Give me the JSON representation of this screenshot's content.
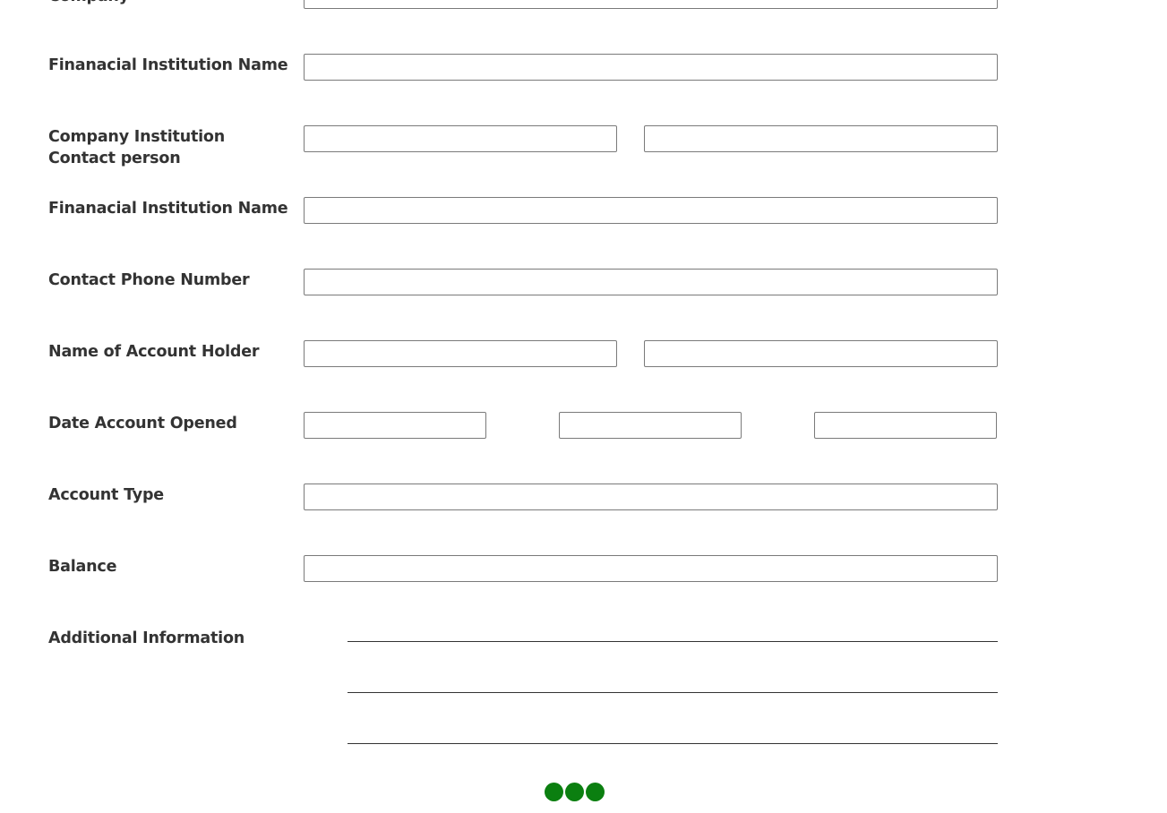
{
  "form": {
    "partial_label_top": "Company",
    "labels": {
      "financial_institution_name_1": "Finanacial Institution Name",
      "company_contact_person": "Company Institution Contact person",
      "financial_institution_name_2": "Finanacial Institution Name",
      "contact_phone_number": "Contact Phone Number",
      "name_of_account_holder": "Name of Account Holder",
      "date_account_opened": "Date Account Opened",
      "account_type": "Account Type",
      "balance": "Balance",
      "additional_information": "Additional Information"
    },
    "values": {
      "top_field": "",
      "financial_institution_name_1": "",
      "contact_person_first": "",
      "contact_person_last": "",
      "financial_institution_name_2": "",
      "contact_phone_number": "",
      "account_holder_first": "",
      "account_holder_last": "",
      "date_month": "",
      "date_day": "",
      "date_year": "",
      "account_type": "",
      "balance": ""
    }
  },
  "pager": {
    "dot_color": "#0b7f10",
    "dots": 3
  }
}
